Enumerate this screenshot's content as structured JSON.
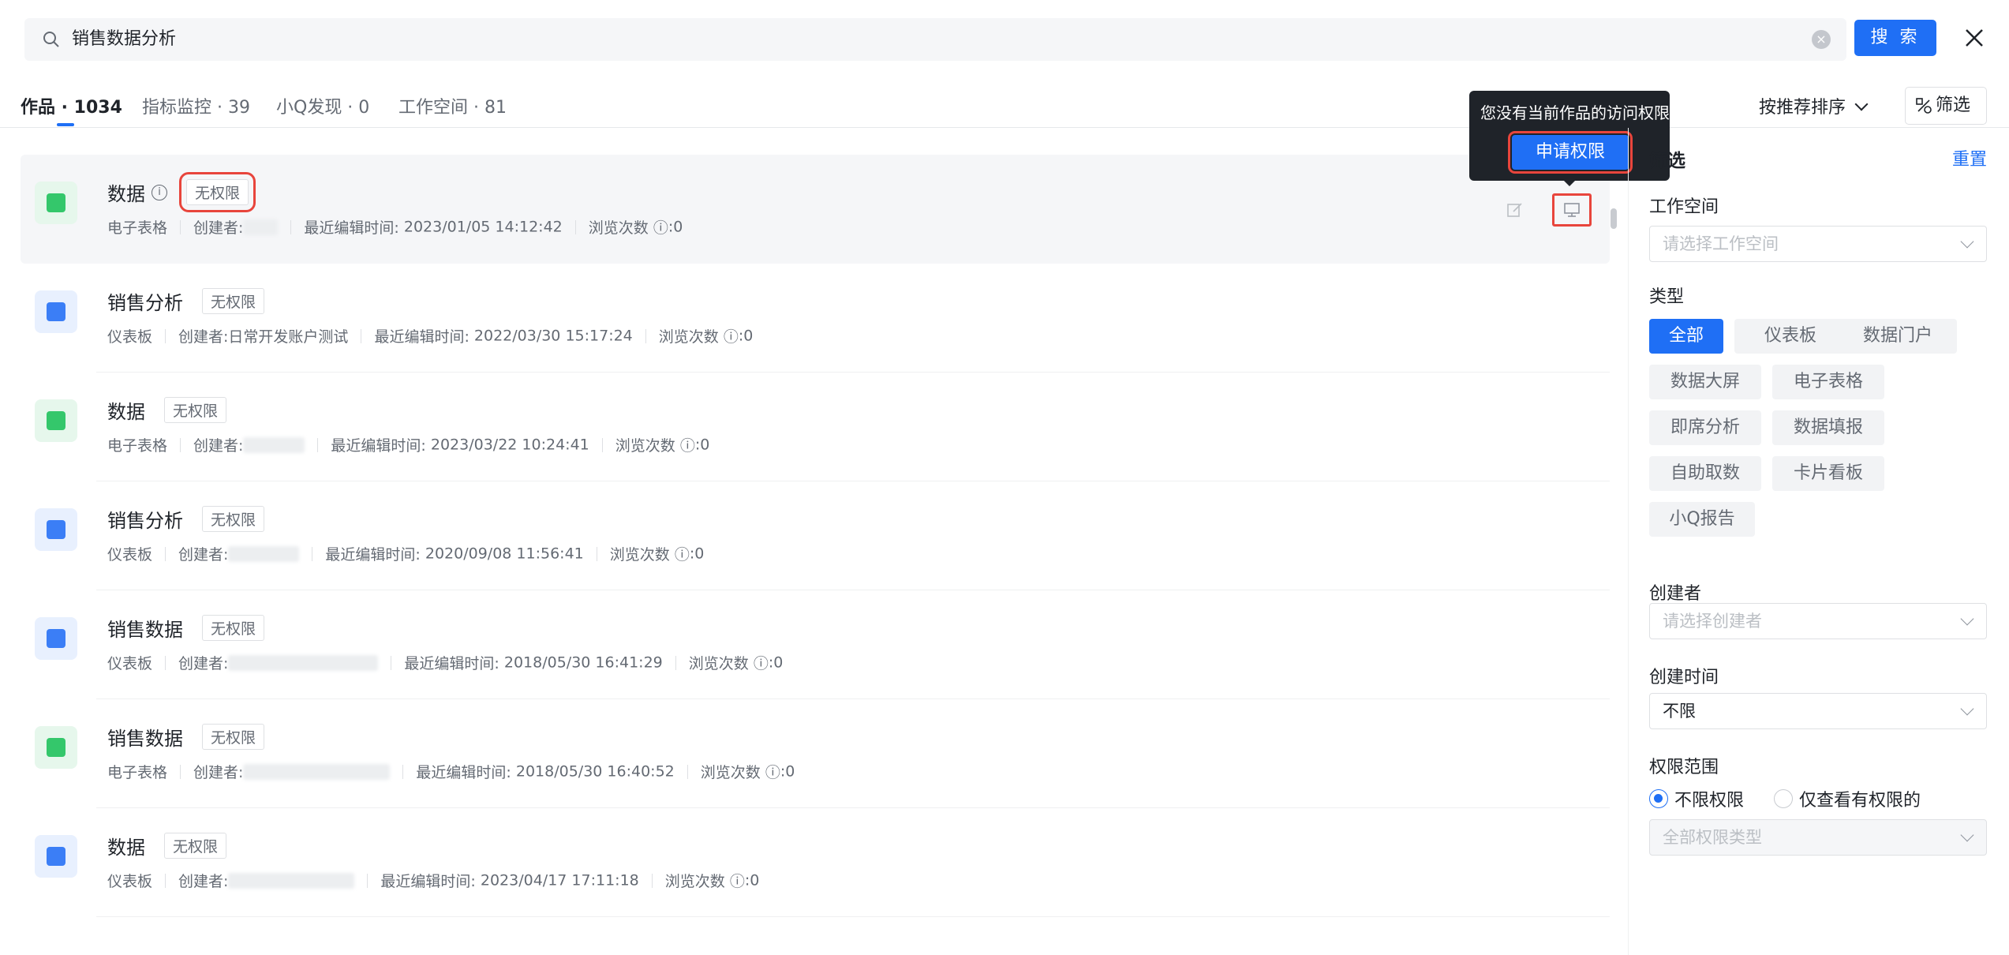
{
  "search": {
    "query": "销售数据分析",
    "button_label": "搜 索"
  },
  "tabs": [
    {
      "label": "作品 · 1034"
    },
    {
      "label": "指标监控 · 39"
    },
    {
      "label": "小Q发现 · 0"
    },
    {
      "label": "工作空间 · 81"
    }
  ],
  "sort": {
    "label": "按推荐排序"
  },
  "filter_button": {
    "label": "筛选"
  },
  "tooltip": {
    "text": "您没有当前作品的访问权限",
    "button_label": "申请权限"
  },
  "items": [
    {
      "title": "数据",
      "badge": "无权限",
      "type": "电子表格",
      "creator_label": "创建者:",
      "edit_label": "最近编辑时间:",
      "edit_time": "2023/01/05 14:12:42",
      "views_label": "浏览次数",
      "views": ":0"
    },
    {
      "title": "销售分析",
      "badge": "无权限",
      "type": "仪表板",
      "creator_label": "创建者:",
      "creator": "日常开发账户测试",
      "edit_label": "最近编辑时间:",
      "edit_time": "2022/03/30 15:17:24",
      "views_label": "浏览次数",
      "views": ":0"
    },
    {
      "title": "数据",
      "badge": "无权限",
      "type": "电子表格",
      "creator_label": "创建者:",
      "edit_label": "最近编辑时间:",
      "edit_time": "2023/03/22 10:24:41",
      "views_label": "浏览次数",
      "views": ":0"
    },
    {
      "title": "销售分析",
      "badge": "无权限",
      "type": "仪表板",
      "creator_label": "创建者:",
      "edit_label": "最近编辑时间:",
      "edit_time": "2020/09/08 11:56:41",
      "views_label": "浏览次数",
      "views": ":0"
    },
    {
      "title": "销售数据",
      "badge": "无权限",
      "type": "仪表板",
      "creator_label": "创建者:",
      "edit_label": "最近编辑时间:",
      "edit_time": "2018/05/30 16:41:29",
      "views_label": "浏览次数",
      "views": ":0"
    },
    {
      "title": "销售数据",
      "badge": "无权限",
      "type": "电子表格",
      "creator_label": "创建者:",
      "edit_label": "最近编辑时间:",
      "edit_time": "2018/05/30 16:40:52",
      "views_label": "浏览次数",
      "views": ":0"
    },
    {
      "title": "数据",
      "badge": "无权限",
      "type": "仪表板",
      "creator_label": "创建者:",
      "edit_label": "最近编辑时间:",
      "edit_time": "2023/04/17 17:11:18",
      "views_label": "浏览次数",
      "views": ":0"
    }
  ],
  "panel": {
    "title": "筛选",
    "reset": "重置",
    "workspace_label": "工作空间",
    "workspace_placeholder": "请选择工作空间",
    "type_label": "类型",
    "types": [
      "全部",
      "仪表板",
      "数据门户",
      "数据大屏",
      "电子表格",
      "即席分析",
      "数据填报",
      "自助取数",
      "卡片看板",
      "小Q报告"
    ],
    "creator_label": "创建者",
    "creator_placeholder": "请选择创建者",
    "created_time_label": "创建时间",
    "created_time_value": "不限",
    "permission_label": "权限范围",
    "permission_options": [
      "不限权限",
      "仅查看有权限的"
    ],
    "permission_type_placeholder": "全部权限类型"
  },
  "colors": {
    "accent": "#1f6ff5",
    "highlight": "#e8453c",
    "sheet_icon": "#34c76b",
    "dash_icon": "#3b7ef6"
  }
}
